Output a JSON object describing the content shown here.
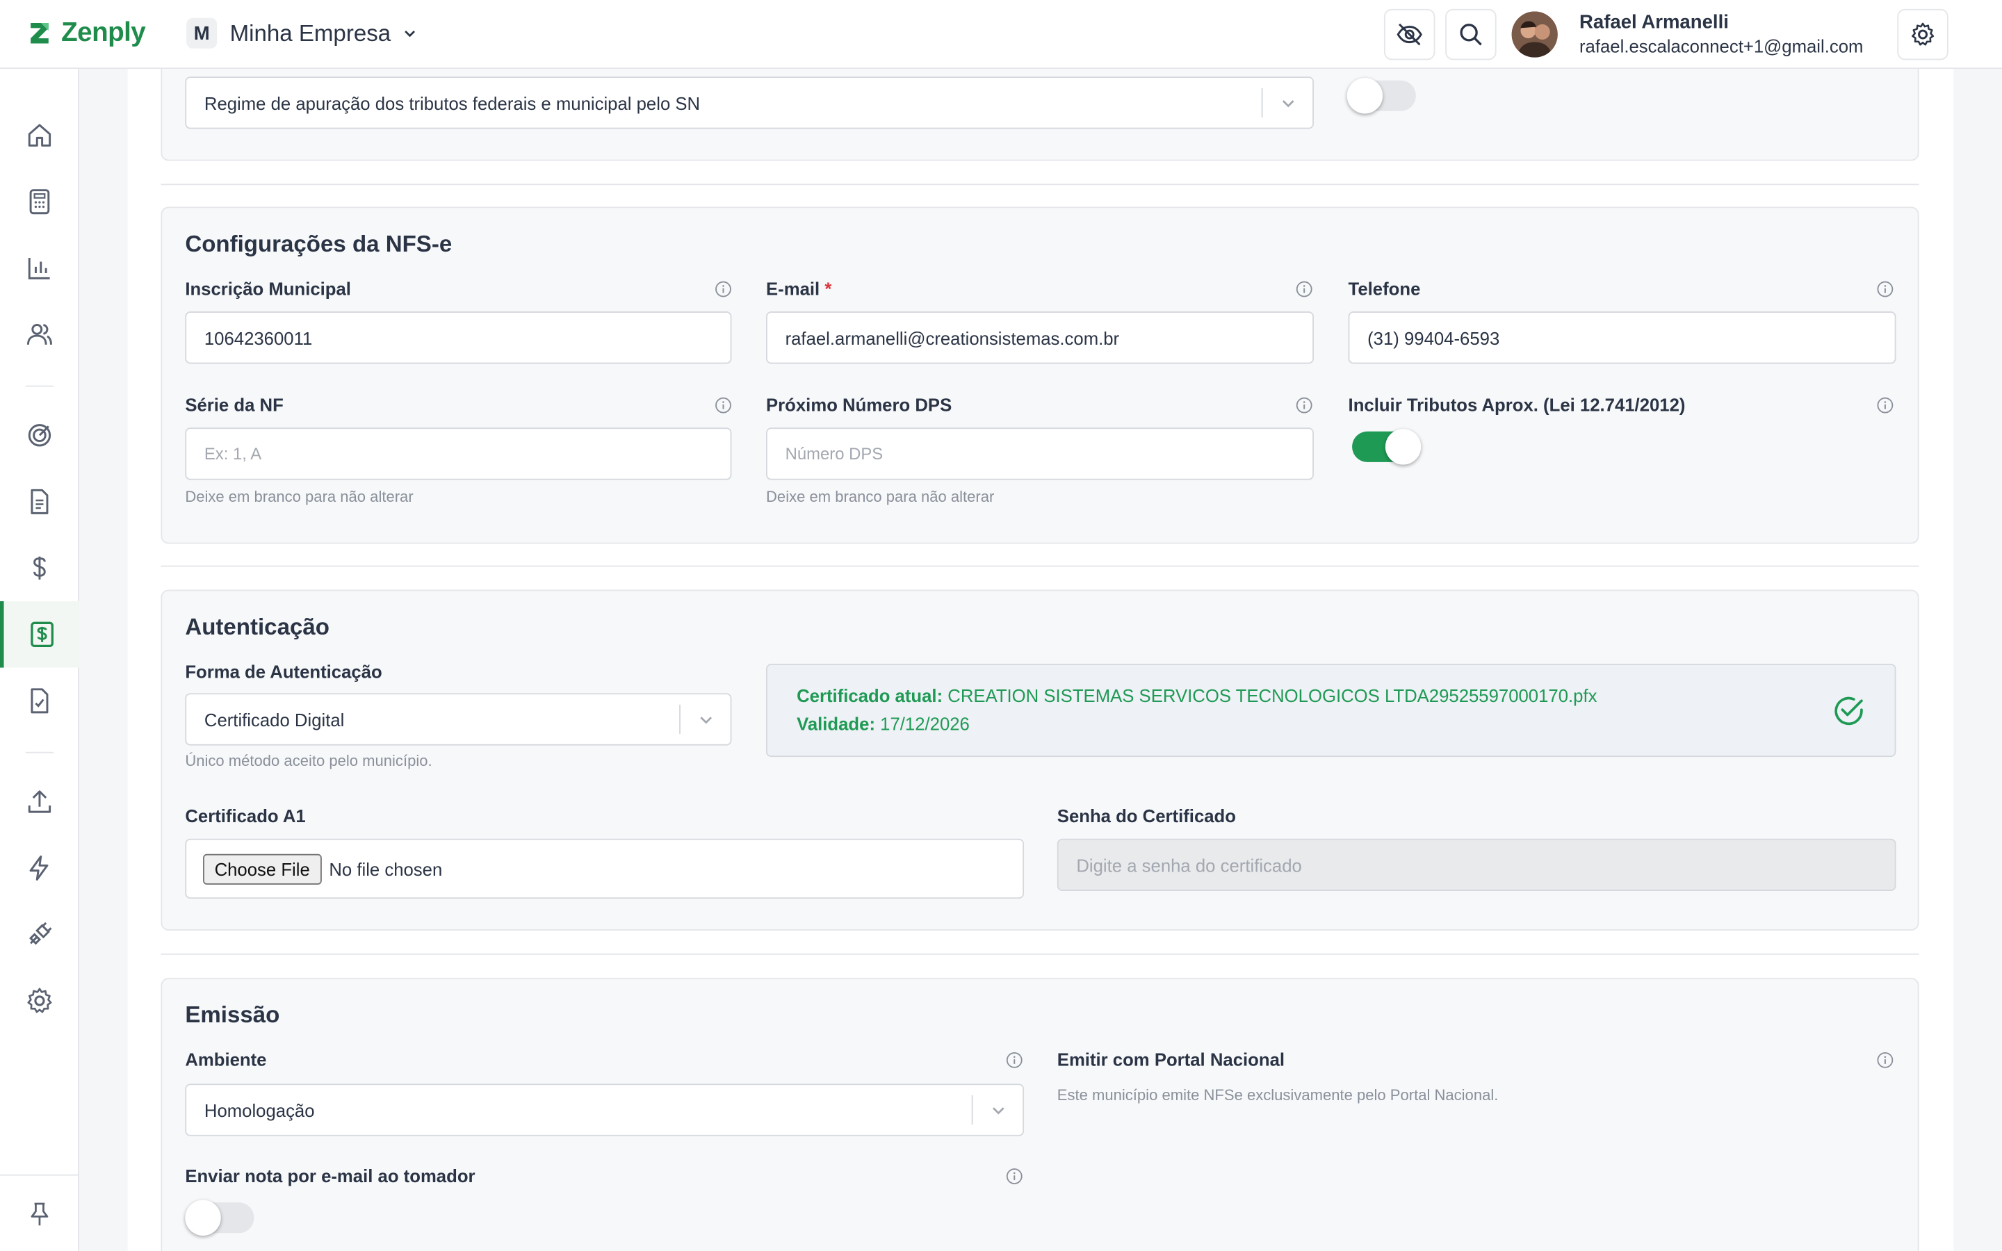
{
  "header": {
    "brand": "Zenply",
    "company_initial": "M",
    "company_name": "Minha Empresa",
    "user_name": "Rafael Armanelli",
    "user_email": "rafael.escalaconnect+1@gmail.com"
  },
  "sidebar": {
    "items": [
      {
        "icon": "home-icon"
      },
      {
        "icon": "calculator-icon"
      },
      {
        "icon": "bar-chart-icon"
      },
      {
        "icon": "users-icon"
      },
      {
        "icon": "target-icon"
      },
      {
        "icon": "document-icon"
      },
      {
        "icon": "dollar-icon"
      },
      {
        "icon": "invoice-dollar-icon",
        "active": true
      },
      {
        "icon": "file-check-icon"
      },
      {
        "icon": "upload-icon"
      },
      {
        "icon": "lightning-icon"
      },
      {
        "icon": "plug-icon"
      },
      {
        "icon": "gear-icon"
      }
    ],
    "pin_icon": "pin-icon"
  },
  "regime": {
    "select_value": "Regime de apuração dos tributos federais e municipal pelo SN",
    "toggle_on": false
  },
  "nfse": {
    "title": "Configurações da NFS-e",
    "inscricao_label": "Inscrição Municipal",
    "inscricao_value": "10642360011",
    "email_label": "E-mail",
    "email_required": "*",
    "email_value": "rafael.armanelli@creationsistemas.com.br",
    "telefone_label": "Telefone",
    "telefone_value": "(31) 99404-6593",
    "serie_label": "Série da NF",
    "serie_placeholder": "Ex: 1, A",
    "serie_hint": "Deixe em branco para não alterar",
    "dps_label": "Próximo Número DPS",
    "dps_placeholder": "Número DPS",
    "dps_hint": "Deixe em branco para não alterar",
    "tributos_label": "Incluir Tributos Aprox. (Lei 12.741/2012)",
    "tributos_toggle_on": true
  },
  "auth": {
    "title": "Autenticação",
    "forma_label": "Forma de Autenticação",
    "forma_value": "Certificado Digital",
    "forma_hint": "Único método aceito pelo município.",
    "cert_atual_label": "Certificado atual:",
    "cert_atual_value": "CREATION SISTEMAS SERVICOS TECNOLOGICOS LTDA29525597000170.pfx",
    "validade_label": "Validade:",
    "validade_value": "17/12/2026",
    "cert_a1_label": "Certificado A1",
    "file_button": "Choose File",
    "file_status": "No file chosen",
    "senha_label": "Senha do Certificado",
    "senha_placeholder": "Digite a senha do certificado"
  },
  "emissao": {
    "title": "Emissão",
    "ambiente_label": "Ambiente",
    "ambiente_value": "Homologação",
    "portal_label": "Emitir com Portal Nacional",
    "portal_hint": "Este município emite NFSe exclusivamente pelo Portal Nacional.",
    "enviar_label": "Enviar nota por e-mail ao tomador",
    "enviar_toggle_on": false
  },
  "colors": {
    "brand_green": "#1f8c4c",
    "toggle_on": "#1f9a55",
    "required": "#d9363e"
  }
}
